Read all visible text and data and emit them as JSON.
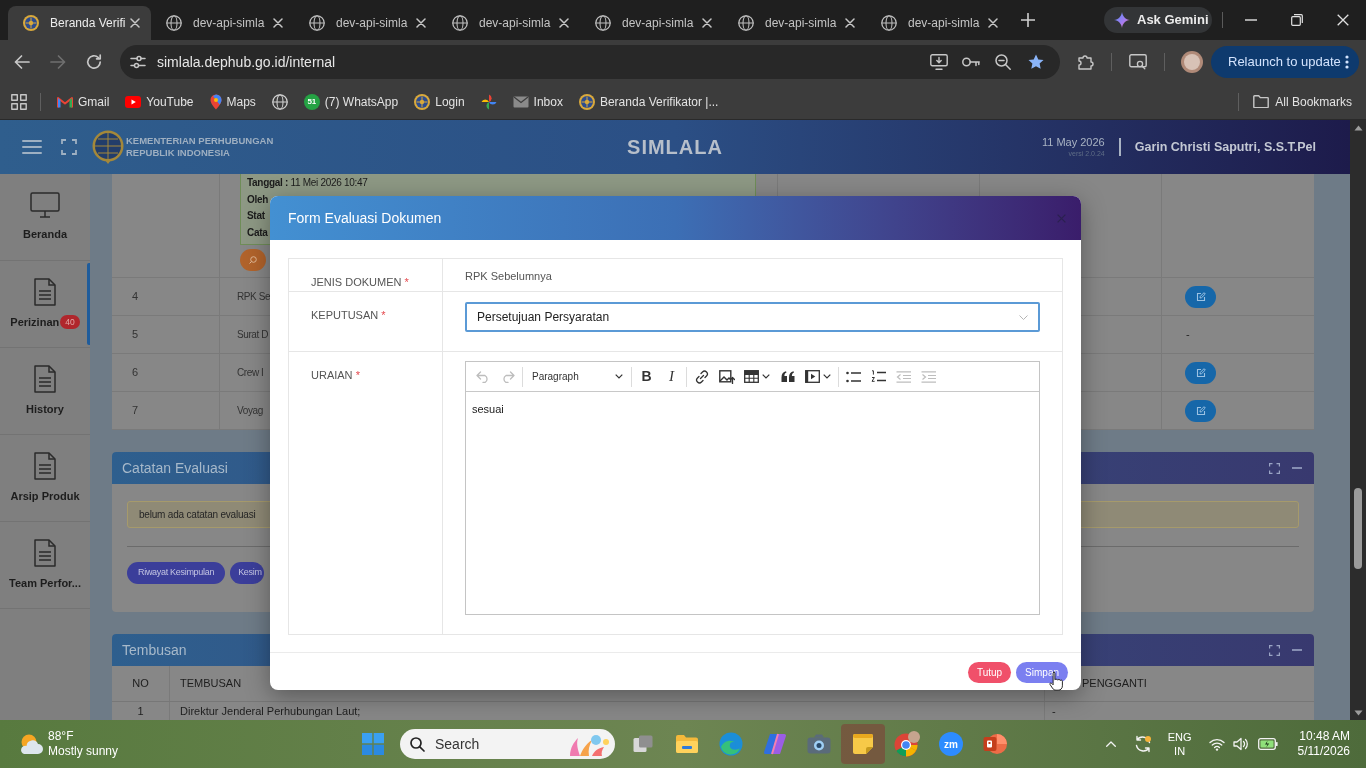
{
  "browser": {
    "tabs": [
      {
        "kind": "emblem",
        "title": "Beranda Verifi",
        "selected": true
      },
      {
        "kind": "globe",
        "title": "dev-api-simla",
        "selected": false
      },
      {
        "kind": "globe",
        "title": "dev-api-simla",
        "selected": false
      },
      {
        "kind": "globe",
        "title": "dev-api-simla",
        "selected": false
      },
      {
        "kind": "globe",
        "title": "dev-api-simla",
        "selected": false
      },
      {
        "kind": "globe",
        "title": "dev-api-simla",
        "selected": false
      },
      {
        "kind": "globe",
        "title": "dev-api-simla",
        "selected": false
      }
    ],
    "gemini_button": "Ask Gemini",
    "url": "simlala.dephub.go.id/internal",
    "relaunch_button": "Relaunch to update",
    "bookmarks": [
      {
        "kind": "gmail",
        "label": "Gmail"
      },
      {
        "kind": "youtube",
        "label": "YouTube"
      },
      {
        "kind": "maps",
        "label": "Maps"
      },
      {
        "kind": "globe"
      },
      {
        "kind": "whatsapp",
        "badge": "51",
        "label": "(7) WhatsApp"
      },
      {
        "kind": "login",
        "label": "Login"
      },
      {
        "kind": "photos"
      },
      {
        "kind": "inbox",
        "label": "Inbox"
      },
      {
        "kind": "site",
        "label": "Beranda Verifikator |..."
      }
    ],
    "all_bookmarks": "All Bookmarks"
  },
  "app_header": {
    "org_lines": [
      "KEMENTERIAN PERHUBUNGAN",
      "REPUBLIK INDONESIA"
    ],
    "title": "SIMLALA",
    "date": "11 May 2026",
    "version": "versi 2.0.24",
    "user": "Garin Christi Saputri, S.S.T.Pel"
  },
  "sidebar": {
    "items": [
      {
        "kind": "monitor",
        "label": "Beranda",
        "selected": false
      },
      {
        "kind": "document",
        "label": "Perizinan",
        "badge": "40",
        "selected": true
      },
      {
        "kind": "document",
        "label": "History",
        "selected": false
      },
      {
        "kind": "document",
        "label": "Arsip Produk",
        "selected": false
      },
      {
        "kind": "document",
        "label": "Team Perfor...",
        "selected": false
      }
    ]
  },
  "documents_table": {
    "note": [
      {
        "label": "Tanggal :",
        "value": "11 Mei 2026 10:47"
      },
      {
        "label": "Oleh"
      },
      {
        "label": "Stat"
      },
      {
        "label": "Cata"
      }
    ],
    "rows": [
      {
        "no": "4",
        "name": "RPK Se",
        "action": {
          "kind": "edit"
        }
      },
      {
        "no": "5",
        "name": "Surat D",
        "action": {
          "kind": "text",
          "text": "-"
        }
      },
      {
        "no": "6",
        "name": "Crew I",
        "action": {
          "kind": "edit"
        }
      },
      {
        "no": "7",
        "name": "Voyag",
        "action": {
          "kind": "edit"
        }
      }
    ]
  },
  "evaluation_notes": {
    "title": "Catatan Evaluasi",
    "alert": "belum ada catatan evaluasi",
    "buttons": [
      "Riwayat Kesimpulan",
      "Kesim"
    ]
  },
  "tembusan": {
    "title": "Tembusan",
    "columns": [
      "NO",
      "TEMBUSAN",
      "PENGGANTI"
    ],
    "rows": [
      [
        "1",
        "Direktur Jenderal Perhubungan Laut;",
        "-"
      ]
    ]
  },
  "modal": {
    "title": "Form Evaluasi Dokumen",
    "fields": [
      {
        "kind": "text",
        "label": "JENIS DOKUMEN",
        "required_mark": "*",
        "value": "RPK Sebelumnya",
        "focused": false
      },
      {
        "kind": "select",
        "label": "KEPUTUSAN",
        "required_mark": "*",
        "value": "Persetujuan Persyaratan",
        "focused": true
      },
      {
        "kind": "editor",
        "label": "URAIAN",
        "required_mark": "*",
        "value": "sesuai",
        "focused": false,
        "toolbar": [
          [
            {
              "kind": "undo",
              "disabled": true
            },
            {
              "kind": "redo",
              "disabled": true
            }
          ],
          [
            {
              "kind": "heading",
              "label": "Paragraph",
              "disabled": false
            }
          ],
          [
            {
              "kind": "bold",
              "label": "B",
              "disabled": false
            },
            {
              "kind": "italic",
              "label": "I",
              "disabled": false
            }
          ],
          [
            {
              "kind": "link",
              "disabled": false
            },
            {
              "kind": "image",
              "disabled": false
            },
            {
              "kind": "table",
              "disabled": false
            },
            {
              "kind": "quote",
              "disabled": false
            },
            {
              "kind": "media",
              "disabled": false
            }
          ],
          [
            {
              "kind": "bullets",
              "disabled": false
            },
            {
              "kind": "numbers",
              "disabled": false
            },
            {
              "kind": "outdent",
              "disabled": true
            },
            {
              "kind": "indent",
              "disabled": true
            }
          ]
        ]
      }
    ],
    "buttons": [
      {
        "kind": "danger",
        "label": "Tutup"
      },
      {
        "kind": "primary",
        "label": "Simpan"
      }
    ]
  },
  "taskbar": {
    "weather": {
      "temperature": "88°F",
      "condition": "Mostly sunny"
    },
    "search": {
      "placeholder": "Search"
    },
    "apps": [
      {
        "kind": "taskview",
        "selected": false
      },
      {
        "kind": "explorer",
        "selected": false
      },
      {
        "kind": "edge",
        "selected": false
      },
      {
        "kind": "copilot",
        "selected": false
      },
      {
        "kind": "camera",
        "selected": false
      },
      {
        "kind": "sticky",
        "selected": true
      },
      {
        "kind": "chrome",
        "selected": false
      },
      {
        "kind": "zoom",
        "label": "zm",
        "selected": false
      },
      {
        "kind": "powerpoint",
        "selected": false
      }
    ],
    "language": [
      "ENG",
      "IN"
    ],
    "time": "10:48 AM",
    "date": "5/11/2026"
  }
}
